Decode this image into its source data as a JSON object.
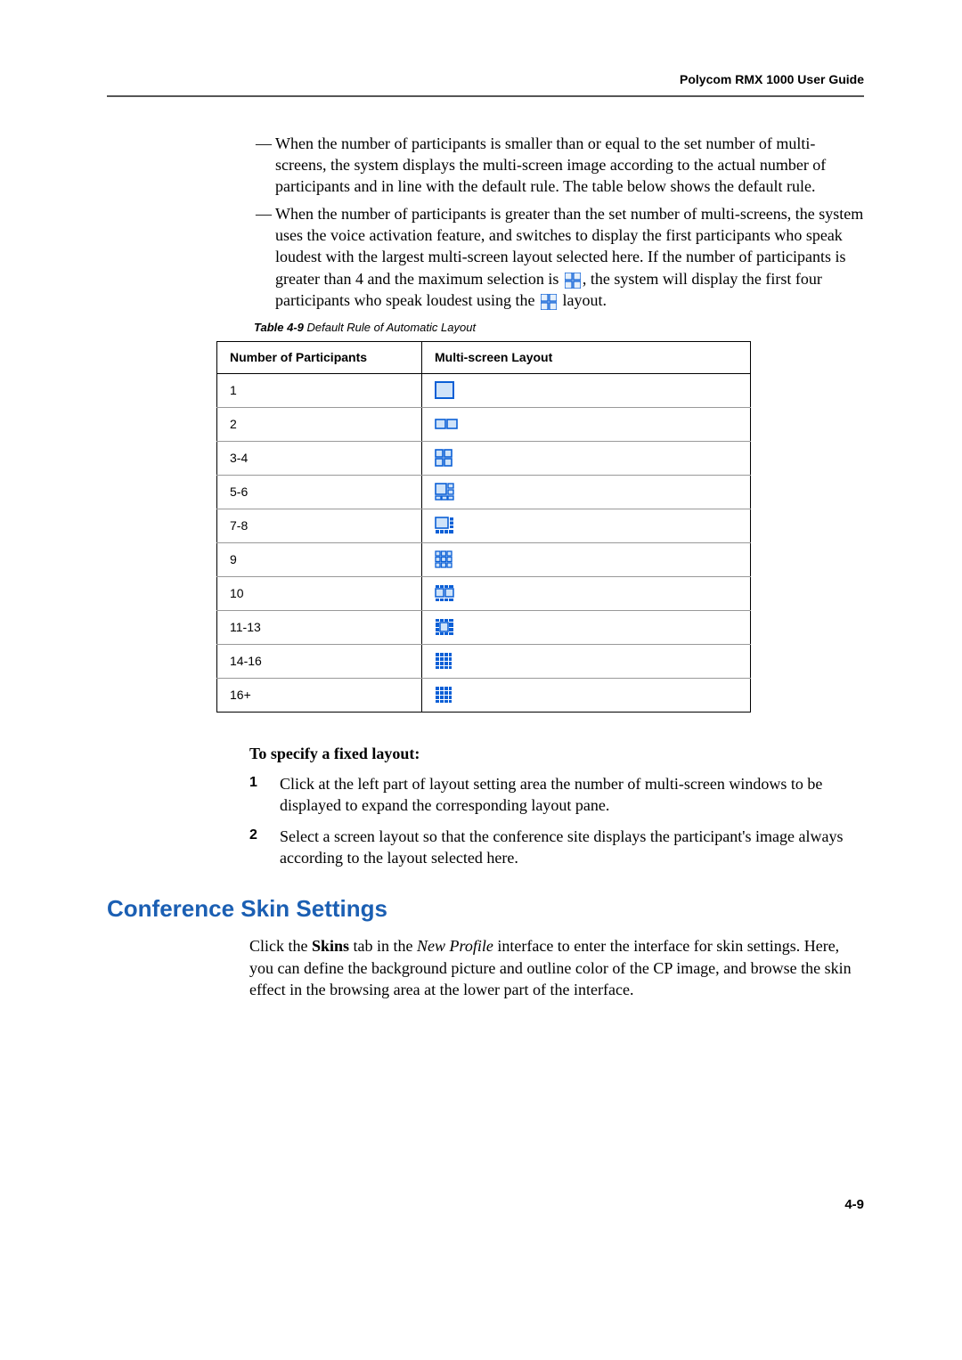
{
  "header": {
    "title": "Polycom RMX 1000 User Guide"
  },
  "bullets": {
    "b1": "When the number of participants is smaller than or equal to the set number of multi-screens, the system displays the multi-screen image according to the actual number of participants and in line with the default rule. The table below shows the default rule.",
    "b2a": "When the number of participants is greater than the set number of multi-screens, the system uses the voice activation feature, and switches to display the first participants who speak loudest with the largest multi-screen layout selected here. If the number of participants is greater than 4 and the maximum selection is ",
    "b2b": ", the system will display the first four participants who speak loudest using the ",
    "b2c": " layout."
  },
  "tableCaption": {
    "label": "Table 4-9",
    "text": " Default Rule of Automatic Layout"
  },
  "tableHeaders": {
    "col1": "Number of Participants",
    "col2": "Multi-screen Layout"
  },
  "tableRows": [
    {
      "participants": "1"
    },
    {
      "participants": "2"
    },
    {
      "participants": "3-4"
    },
    {
      "participants": "5-6"
    },
    {
      "participants": "7-8"
    },
    {
      "participants": "9"
    },
    {
      "participants": "10"
    },
    {
      "participants": "11-13"
    },
    {
      "participants": "14-16"
    },
    {
      "participants": "16+"
    }
  ],
  "fixedLayout": {
    "heading": "To specify a fixed layout:",
    "step1": "Click at the left part of layout setting area the number of multi-screen windows to be displayed to expand the corresponding layout pane.",
    "step2": "Select a screen layout so that the conference site displays the participant's image always according to the layout selected here."
  },
  "section": {
    "heading": "Conference Skin Settings",
    "para_a": "Click the ",
    "para_b": "Skins",
    "para_c": " tab in the ",
    "para_d": "New Profile",
    "para_e": " interface to enter the interface for skin settings. Here, you can define the background picture and outline color of the CP image, and browse the skin effect in the browsing area at the lower part of the interface."
  },
  "pageNumber": "4-9"
}
